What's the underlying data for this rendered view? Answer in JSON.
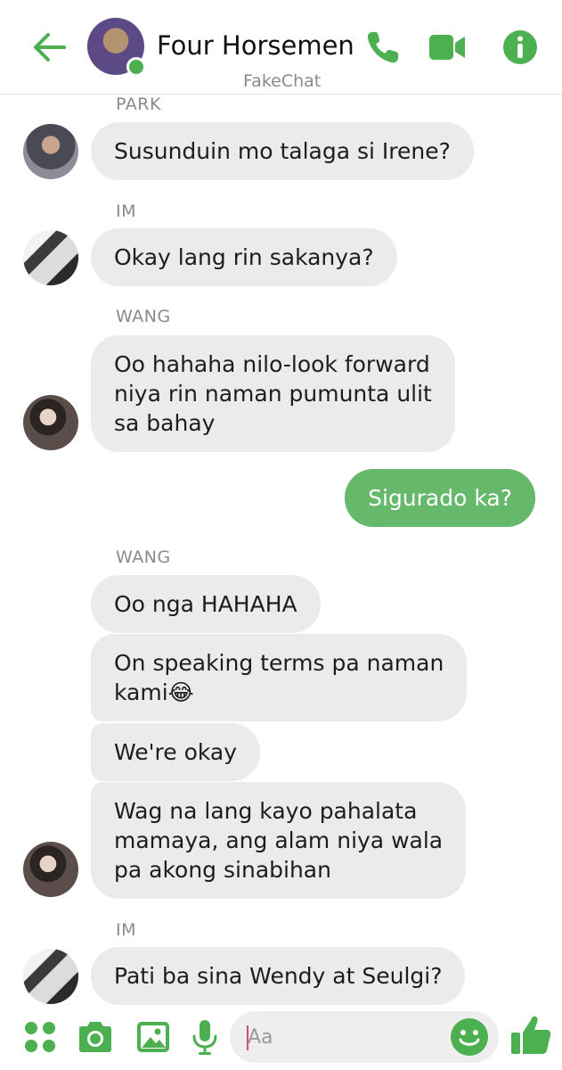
{
  "header": {
    "title": "Four Horsemen",
    "subtitle": "FakeChat",
    "accent_color": "#4caf50",
    "icons": [
      "back-arrow-icon",
      "phone-icon",
      "video-camera-icon",
      "info-icon"
    ]
  },
  "messages": [
    {
      "sender": "PARK",
      "avatar": "park",
      "lines": [
        "Susunduin mo talaga si Irene?"
      ]
    },
    {
      "sender": "IM",
      "avatar": "im",
      "lines": [
        "Okay lang rin sakanya?"
      ]
    },
    {
      "sender": "WANG",
      "avatar": "wang",
      "lines": [
        "Oo hahaha nilo-look forward",
        "niya rin naman pumunta ulit",
        "sa bahay"
      ]
    },
    {
      "sender": "",
      "outgoing": true,
      "lines": [
        "Sigurado ka?"
      ]
    },
    {
      "sender": "WANG",
      "lines": [
        "Oo nga HAHAHA"
      ]
    },
    {
      "sender": "",
      "lines": [
        "On speaking terms pa naman",
        "kami😂"
      ]
    },
    {
      "sender": "",
      "lines": [
        "We're okay"
      ]
    },
    {
      "sender": "",
      "avatar": "wang",
      "lines": [
        "Wag na lang kayo pahalata",
        "mamaya, ang alam niya wala",
        "pa akong sinabihan"
      ]
    },
    {
      "sender": "IM",
      "avatar": "im",
      "lines": [
        "Pati ba sina Wendy at Seulgi?"
      ]
    }
  ],
  "composer": {
    "placeholder": "Aa",
    "icons": [
      "apps-grid-icon",
      "camera-icon",
      "image-icon",
      "microphone-icon",
      "emoji-icon",
      "thumbs-up-icon"
    ]
  },
  "colors": {
    "accent": "#4caf50",
    "outgoing_bubble": "#66b96a",
    "incoming_bubble": "#ebebeb"
  }
}
